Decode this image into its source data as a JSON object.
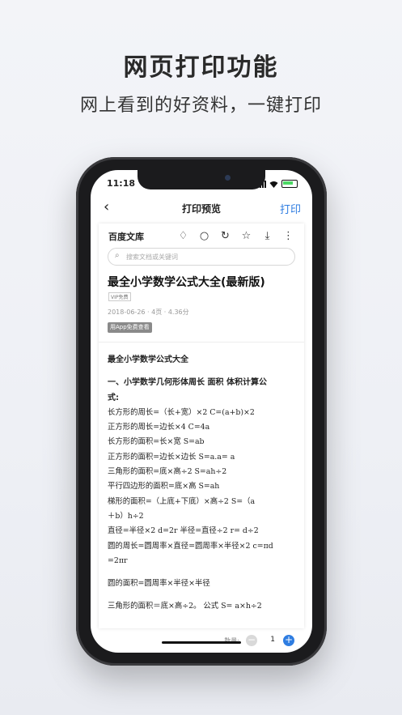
{
  "promo": {
    "headline": "网页打印功能",
    "subline": "网上看到的好资料，一键打印"
  },
  "status_bar": {
    "time": "11:18"
  },
  "navbar": {
    "back_icon": "chevron-left-icon",
    "title": "打印预览",
    "print_label": "打印"
  },
  "doc_header": {
    "brand": "百度文库",
    "tools": [
      "diamond-icon",
      "search-icon",
      "refresh-icon",
      "star-icon",
      "download-icon",
      "more-icon"
    ],
    "search_placeholder": "搜索文档或关键词"
  },
  "document": {
    "title": "最全小学数学公式大全(最新版)",
    "vip_tag": "VIP免费",
    "meta": "2018-06-26 · 4页 · 4.36分",
    "open_app": "用App免费查看",
    "lines": [
      "最全小学数学公式大全",
      "一、小学数学几何形体周长 面积 体积计算公",
      "式:",
      "长方形的周长=（长+宽）×2 C=(a+b)×2",
      "正方形的周长=边长×4 C=4a",
      "长方形的面积=长×宽 S=ab",
      "正方形的面积=边长×边长 S=a.a= a",
      "三角形的面积=底×高÷2 S=ah÷2",
      "平行四边形的面积=底×高 S=ah",
      "梯形的面积=（上底+下底）×高÷2 S=（a",
      "＋b）h÷2",
      "直径=半径×2 d=2r 半径=直径÷2 r= d÷2",
      "圆的周长=圆周率×直径=圆周率×半径×2 c=πd",
      "=2πr",
      "圆的面积=圆周率×半径×半径",
      "三角形的面积＝底×高÷2。 公式 S= a×h÷2"
    ]
  },
  "bottom_bar": {
    "qty_label": "数量:",
    "qty": "1",
    "minus": "−",
    "plus": "+"
  },
  "colors": {
    "accent": "#2f7de1"
  }
}
